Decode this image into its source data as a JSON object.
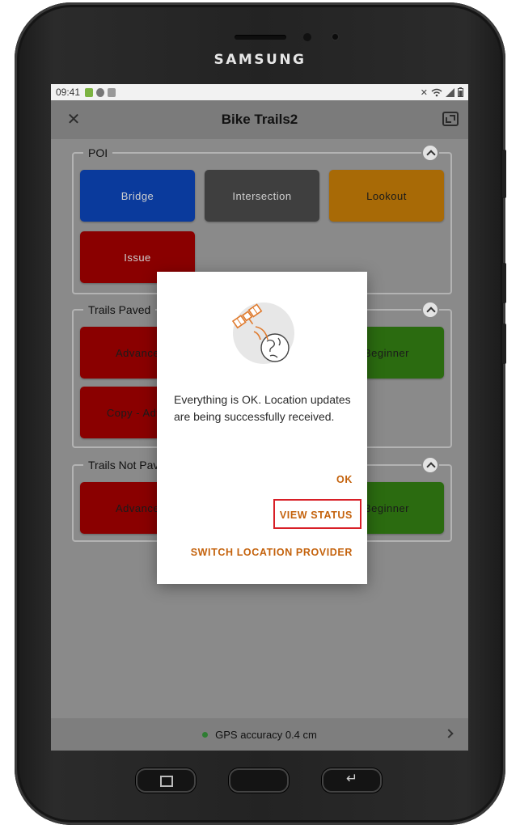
{
  "device": {
    "brand": "SAMSUNG"
  },
  "status_bar": {
    "time": "09:41"
  },
  "header": {
    "title": "Bike Trails2"
  },
  "groups": [
    {
      "title": "POI",
      "tiles": [
        {
          "label": "Bridge",
          "color": "#0a3a9c"
        },
        {
          "label": "Intersection",
          "color": "#3f3f3f"
        },
        {
          "label": "Lookout",
          "color": "#a86a06"
        },
        {
          "label": "Issue",
          "color": "#8a0000"
        }
      ]
    },
    {
      "title": "Trails Paved",
      "tiles": [
        {
          "label": "Advance",
          "color": "#8a0000"
        },
        {
          "label": "Beginner",
          "color": "#2b6b10"
        },
        {
          "label": "Copy - Adva",
          "color": "#8a0000"
        }
      ]
    },
    {
      "title": "Trails Not Pav",
      "tiles": [
        {
          "label": "Advance",
          "color": "#8a0000"
        },
        {
          "label": "Beginner",
          "color": "#2b6b10"
        }
      ]
    }
  ],
  "dialog": {
    "message": "Everything is OK. Location updates are being successfully received.",
    "ok_label": "OK",
    "view_status_label": "VIEW STATUS",
    "switch_provider_label": "SWITCH LOCATION PROVIDER",
    "accent_color": "#c4620c",
    "highlight_color": "#d81f27"
  },
  "gps": {
    "text": "GPS accuracy 0.4 cm",
    "dot_color": "#2e7d32"
  }
}
